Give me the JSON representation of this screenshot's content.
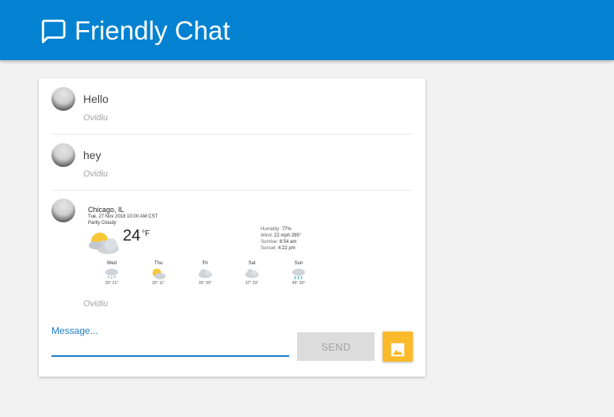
{
  "app": {
    "title": "Friendly Chat",
    "colors": {
      "header": "#0282d1",
      "accent": "#1a7ccc",
      "image_button": "#fcb929"
    }
  },
  "messages": [
    {
      "text": "Hello",
      "sender": "Ovidiu"
    },
    {
      "text": "hey",
      "sender": "Ovidiu"
    },
    {
      "text": "",
      "sender": "Ovidiu",
      "image": "weather-widget"
    }
  ],
  "weather": {
    "city": "Chicago, IL",
    "date": "Tue, 27 Nov 2018 10:00 AM CST",
    "condition": "Partly Cloudy",
    "temp": "24",
    "unit": "°F",
    "humidity_label": "Humidity:",
    "humidity": "77%",
    "wind_label": "Wind:",
    "wind": "22 mph 295°",
    "sunrise_label": "Sunrise:",
    "sunrise": "6:54 am",
    "sunset_label": "Sunset:",
    "sunset": "4:22 pm",
    "forecast": [
      {
        "day": "Wed",
        "temps": "25° 21°",
        "icon": "snow-icon"
      },
      {
        "day": "Thu",
        "temps": "30° 11°",
        "icon": "partly-sunny-icon"
      },
      {
        "day": "Fri",
        "temps": "35° 30°",
        "icon": "cloudy-icon"
      },
      {
        "day": "Sat",
        "temps": "37° 29°",
        "icon": "cloudy-icon"
      },
      {
        "day": "Sun",
        "temps": "45° 30°",
        "icon": "rain-icon"
      }
    ]
  },
  "composer": {
    "label": "Message...",
    "value": "",
    "send_label": "SEND"
  }
}
